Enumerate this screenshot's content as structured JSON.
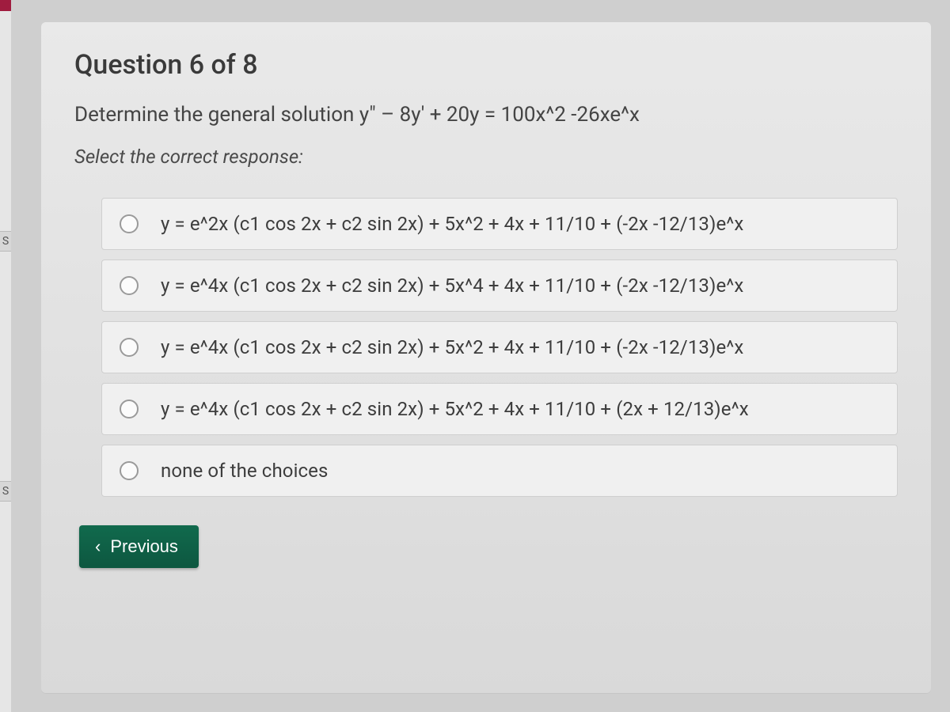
{
  "left_rail": {
    "tab1": "S",
    "tab2": "S"
  },
  "question": {
    "title": "Question 6 of 8",
    "prompt": "Determine the general solution y\" – 8y' + 20y = 100x^2 -26xe^x",
    "subprompt": "Select the correct response:"
  },
  "choices": [
    {
      "label": "y = e^2x (c1 cos 2x + c2 sin 2x) + 5x^2 + 4x + 11/10 + (-2x -12/13)e^x"
    },
    {
      "label": "y = e^4x (c1 cos 2x + c2 sin 2x) + 5x^4 + 4x + 11/10 + (-2x -12/13)e^x"
    },
    {
      "label": "y = e^4x (c1 cos 2x + c2 sin 2x) + 5x^2 + 4x + 11/10 + (-2x -12/13)e^x"
    },
    {
      "label": "y = e^4x (c1 cos 2x + c2 sin 2x) + 5x^2 + 4x + 11/10 + (2x + 12/13)e^x"
    },
    {
      "label": "none of the choices"
    }
  ],
  "nav": {
    "previous": "Previous"
  }
}
